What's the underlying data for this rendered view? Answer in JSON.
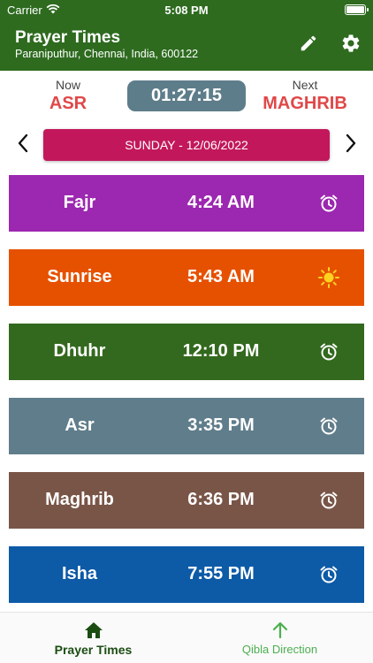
{
  "status_bar": {
    "carrier": "Carrier",
    "time": "5:08 PM",
    "wifi_icon": "wifi-icon",
    "battery_icon": "battery-icon"
  },
  "app_bar": {
    "title": "Prayer Times",
    "location": "Paraniputhur, Chennai, India, 600122",
    "edit_icon": "pencil-icon",
    "settings_icon": "gear-icon",
    "background": "#2e6b1f"
  },
  "current": {
    "now_label": "Now",
    "now_prayer": "ASR",
    "countdown": "01:27:15",
    "next_label": "Next",
    "next_prayer": "MAGHRIB",
    "accent": "#e04848"
  },
  "date_bar": {
    "label": "SUNDAY - 12/06/2022",
    "color": "#c2185b",
    "prev_icon": "chevron-left-icon",
    "next_icon": "chevron-right-icon"
  },
  "prayers": [
    {
      "name": "Fajr",
      "time": "4:24 AM",
      "color": "#9c27b0",
      "icon": "alarm-icon"
    },
    {
      "name": "Sunrise",
      "time": "5:43 AM",
      "color": "#e65100",
      "icon": "sun-icon"
    },
    {
      "name": "Dhuhr",
      "time": "12:10 PM",
      "color": "#33691e",
      "icon": "alarm-icon"
    },
    {
      "name": "Asr",
      "time": "3:35 PM",
      "color": "#607d8b",
      "icon": "alarm-icon"
    },
    {
      "name": "Maghrib",
      "time": "6:36 PM",
      "color": "#795548",
      "icon": "alarm-icon"
    },
    {
      "name": "Isha",
      "time": "7:55 PM",
      "color": "#0d5aa7",
      "icon": "alarm-icon"
    }
  ],
  "bottom_nav": [
    {
      "label": "Prayer Times",
      "icon": "home-icon",
      "active": true
    },
    {
      "label": "Qibla Direction",
      "icon": "arrow-up-icon",
      "active": false
    }
  ]
}
